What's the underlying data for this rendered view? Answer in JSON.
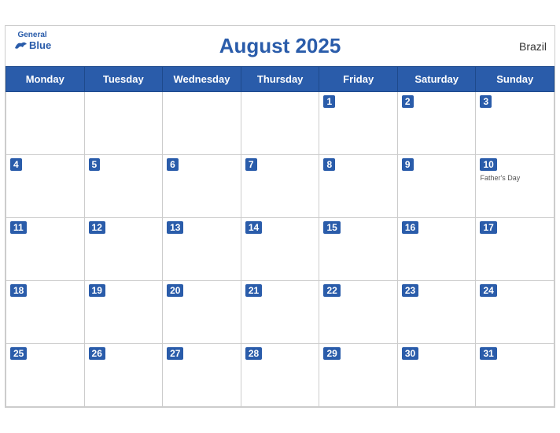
{
  "header": {
    "title": "August 2025",
    "country": "Brazil",
    "logo_general": "General",
    "logo_blue": "Blue"
  },
  "weekdays": [
    "Monday",
    "Tuesday",
    "Wednesday",
    "Thursday",
    "Friday",
    "Saturday",
    "Sunday"
  ],
  "weeks": [
    [
      {
        "day": "",
        "empty": true
      },
      {
        "day": "",
        "empty": true
      },
      {
        "day": "",
        "empty": true
      },
      {
        "day": "",
        "empty": true
      },
      {
        "day": "1"
      },
      {
        "day": "2"
      },
      {
        "day": "3"
      }
    ],
    [
      {
        "day": "4"
      },
      {
        "day": "5"
      },
      {
        "day": "6"
      },
      {
        "day": "7"
      },
      {
        "day": "8"
      },
      {
        "day": "9"
      },
      {
        "day": "10",
        "holiday": "Father's Day"
      }
    ],
    [
      {
        "day": "11"
      },
      {
        "day": "12"
      },
      {
        "day": "13"
      },
      {
        "day": "14"
      },
      {
        "day": "15"
      },
      {
        "day": "16"
      },
      {
        "day": "17"
      }
    ],
    [
      {
        "day": "18"
      },
      {
        "day": "19"
      },
      {
        "day": "20"
      },
      {
        "day": "21"
      },
      {
        "day": "22"
      },
      {
        "day": "23"
      },
      {
        "day": "24"
      }
    ],
    [
      {
        "day": "25"
      },
      {
        "day": "26"
      },
      {
        "day": "27"
      },
      {
        "day": "28"
      },
      {
        "day": "29"
      },
      {
        "day": "30"
      },
      {
        "day": "31"
      }
    ]
  ]
}
